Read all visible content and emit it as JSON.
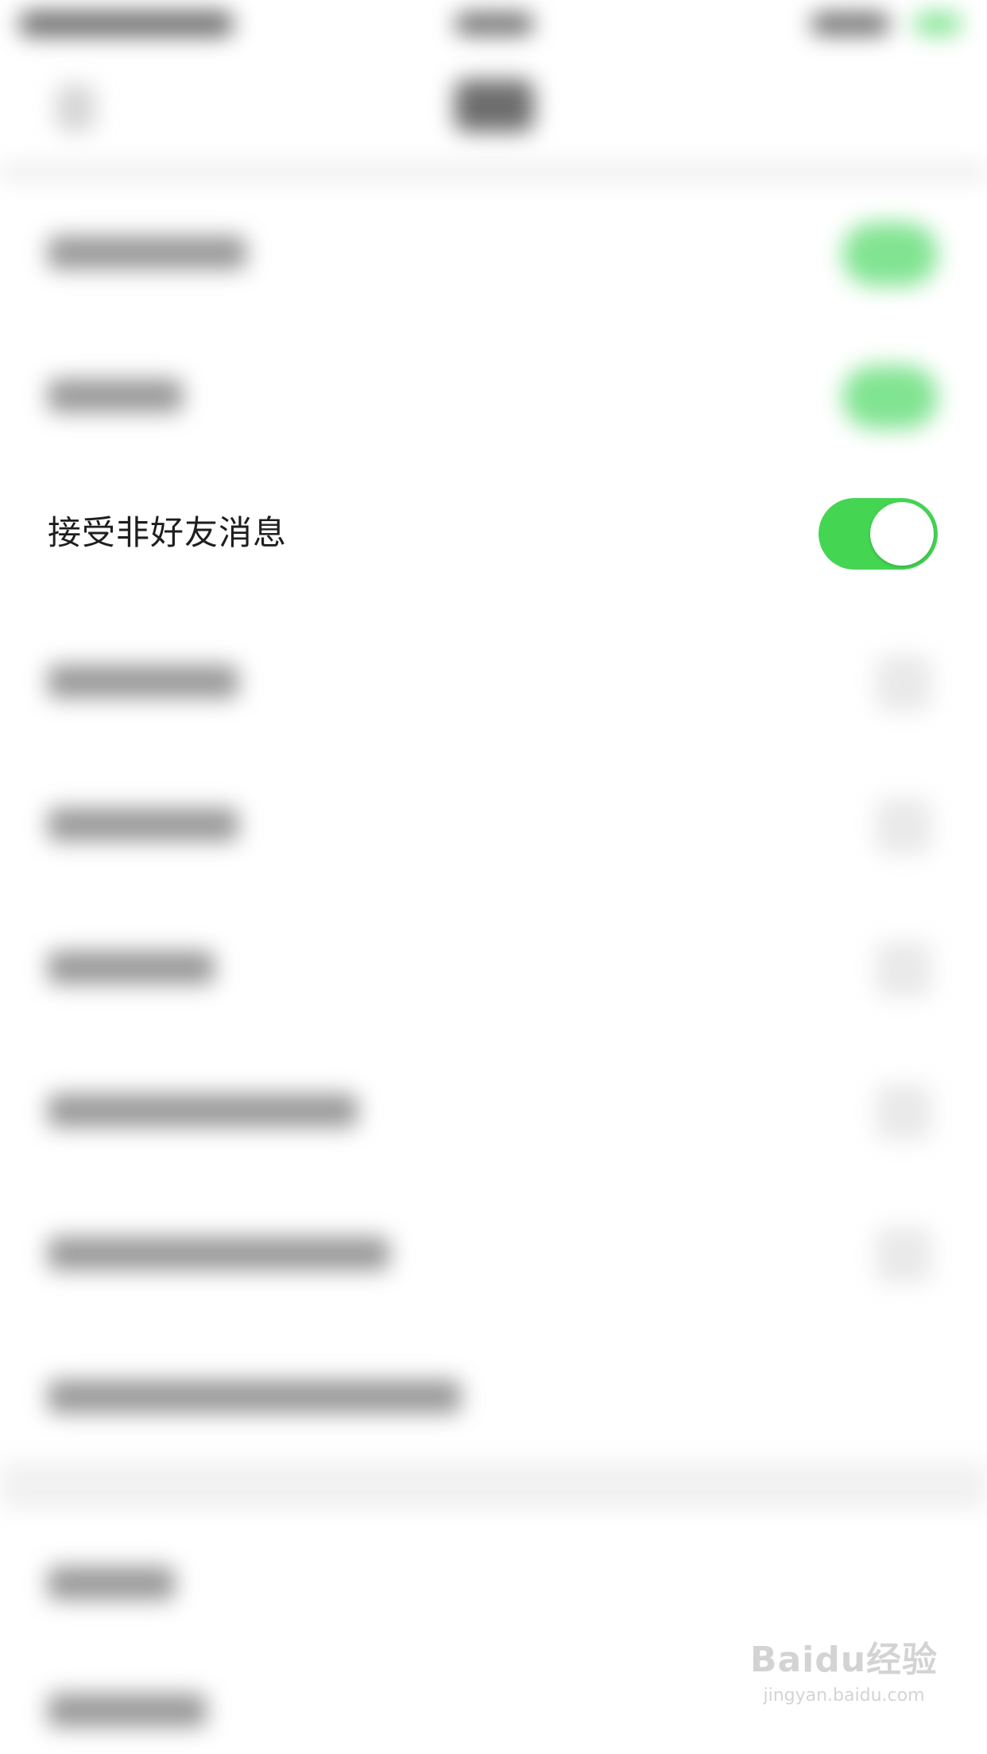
{
  "settings": {
    "focused_row": {
      "label": "接受非好友消息",
      "toggle_on": true
    }
  },
  "watermark": {
    "logo": "Baidu经验",
    "url": "jingyan.baidu.com"
  },
  "colors": {
    "toggle_on": "#44d552",
    "label_text": "#1e1e1e",
    "background": "#ffffff"
  }
}
